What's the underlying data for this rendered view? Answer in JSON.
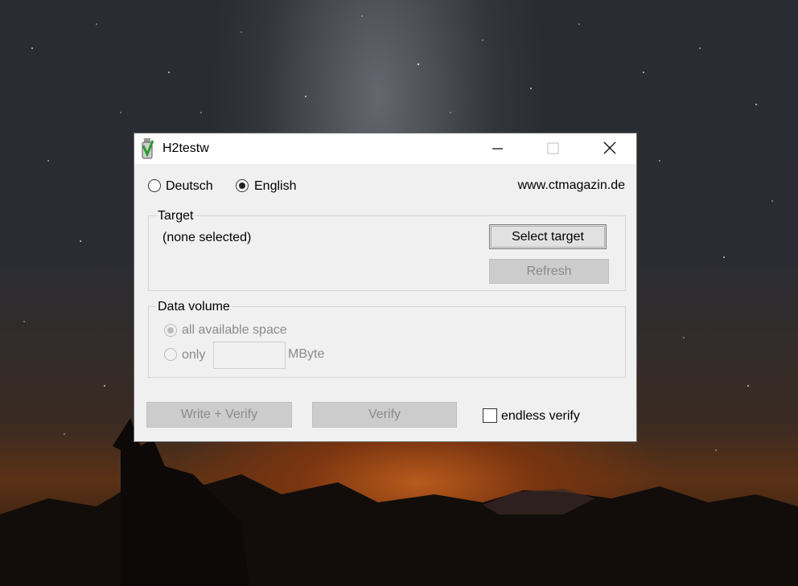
{
  "window": {
    "title": "H2testw",
    "min_icon": "minimize-icon",
    "max_icon": "maximize-icon",
    "close_icon": "close-icon"
  },
  "language": {
    "deutsch_label": "Deutsch",
    "english_label": "English",
    "selected": "English",
    "website": "www.ctmagazin.de"
  },
  "target": {
    "group_label": "Target",
    "value": "(none selected)",
    "select_label": "Select target",
    "refresh_label": "Refresh"
  },
  "data_volume": {
    "group_label": "Data volume",
    "all_label": "all available space",
    "only_label": "only",
    "only_value": "",
    "unit": "MByte"
  },
  "actions": {
    "write_verify_label": "Write + Verify",
    "verify_label": "Verify",
    "endless_label": "endless verify",
    "endless_checked": false
  },
  "colors": {
    "window_bg": "#f0f0f0",
    "disabled_text": "#8a8a8a"
  }
}
